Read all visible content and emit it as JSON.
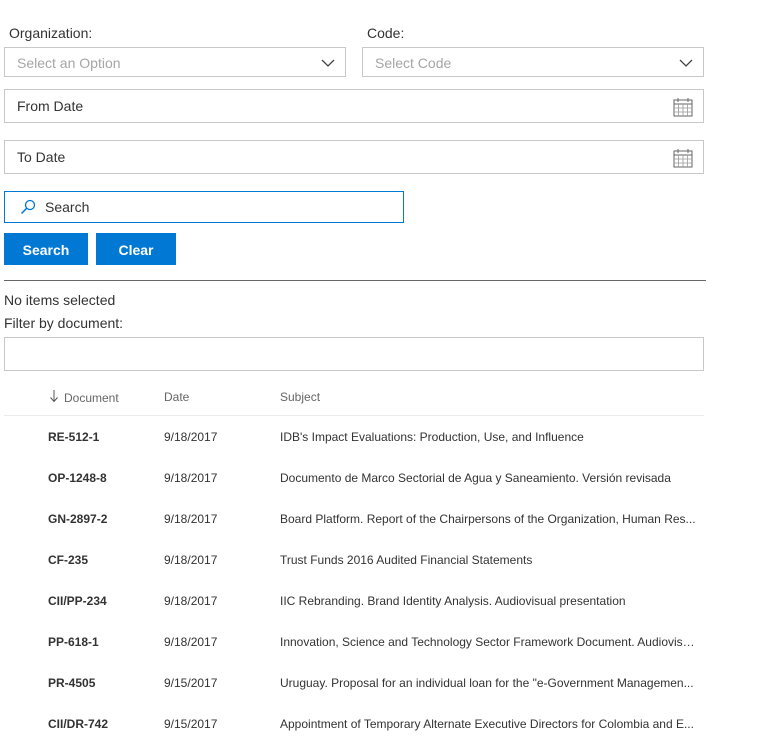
{
  "filters": {
    "organization_label": "Organization:",
    "organization_placeholder": "Select an Option",
    "code_label": "Code:",
    "code_placeholder": "Select Code",
    "from_date": "From Date",
    "to_date": "To Date",
    "search_placeholder": "Search"
  },
  "buttons": {
    "search": "Search",
    "clear": "Clear"
  },
  "selection_status": "No items selected",
  "filter_by_document_label": "Filter by document:",
  "table": {
    "columns": [
      "Document",
      "Date",
      "Subject"
    ],
    "sorted_column": "Document",
    "sort_direction": "descending",
    "rows": [
      {
        "document": "RE-512-1",
        "date": "9/18/2017",
        "subject": "IDB's Impact Evaluations: Production, Use, and Influence"
      },
      {
        "document": "OP-1248-8",
        "date": "9/18/2017",
        "subject": "Documento de Marco Sectorial de Agua y Saneamiento. Versión revisada"
      },
      {
        "document": "GN-2897-2",
        "date": "9/18/2017",
        "subject": "Board Platform. Report of the Chairpersons of the Organization, Human Res..."
      },
      {
        "document": "CF-235",
        "date": "9/18/2017",
        "subject": "Trust Funds 2016 Audited Financial Statements"
      },
      {
        "document": "CII/PP-234",
        "date": "9/18/2017",
        "subject": "IIC Rebranding. Brand Identity Analysis. Audiovisual presentation"
      },
      {
        "document": "PP-618-1",
        "date": "9/18/2017",
        "subject": "Innovation, Science and Technology Sector Framework Document. Audiovisu..."
      },
      {
        "document": "PR-4505",
        "date": "9/15/2017",
        "subject": "Uruguay. Proposal for an individual loan for the \"e-Government Managemen..."
      },
      {
        "document": "CII/DR-742",
        "date": "9/15/2017",
        "subject": "Appointment of Temporary Alternate Executive Directors for Colombia and E..."
      }
    ]
  },
  "colors": {
    "accent": "#0078d4",
    "border": "#c8c8c8",
    "placeholder": "#a6a6a6"
  }
}
